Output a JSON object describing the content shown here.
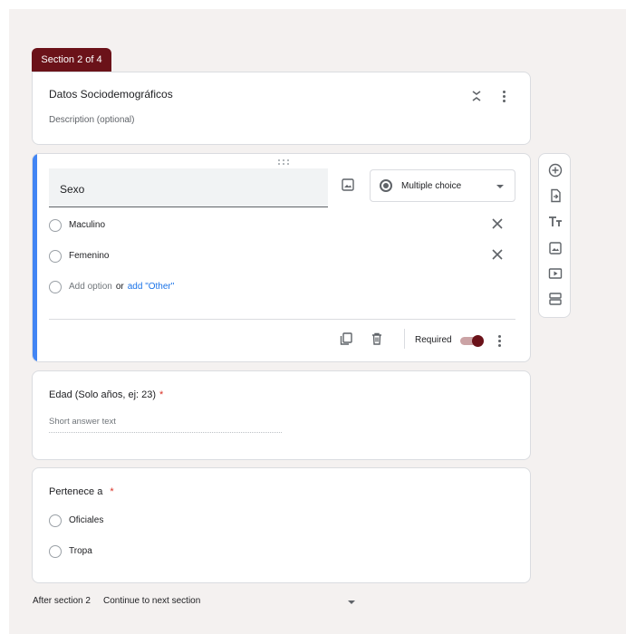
{
  "section": {
    "badge": "Section 2 of 4",
    "title": "Datos Sociodemográficos",
    "description_placeholder": "Description (optional)"
  },
  "active_question": {
    "title": "Sexo",
    "type": "Multiple choice",
    "options": [
      "Maculino",
      "Femenino"
    ],
    "add_option": "Add option",
    "or": "or",
    "add_other": "add \"Other\"",
    "required_label": "Required",
    "required": true
  },
  "question_2": {
    "title": "Edad (Solo años, ej: 23)",
    "required_mark": "*",
    "placeholder": "Short answer text"
  },
  "question_3": {
    "title": "Pertenece a",
    "required_mark": "*",
    "options": [
      "Oficiales",
      "Tropa"
    ]
  },
  "after_section": {
    "label": "After section 2",
    "value": "Continue to next section"
  },
  "toolbar_icons": [
    "add-question-icon",
    "import-questions-icon",
    "add-title-icon",
    "add-image-icon",
    "add-video-icon",
    "add-section-icon"
  ],
  "colors": {
    "accent": "#6b1219",
    "focus": "#4285f4",
    "link": "#1a73e8",
    "required": "#d93025"
  }
}
